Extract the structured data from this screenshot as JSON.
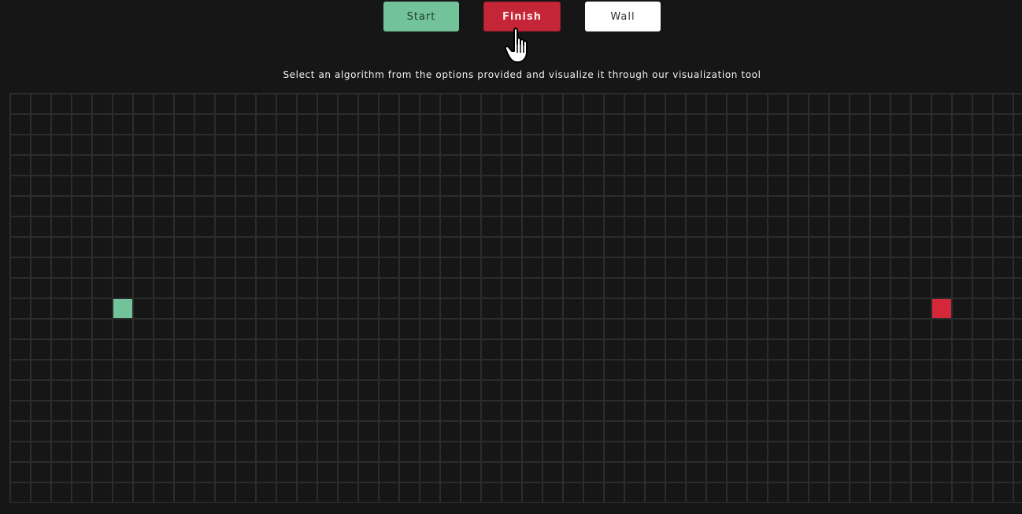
{
  "toolbar": {
    "start_label": "Start",
    "finish_label": "Finish",
    "wall_label": "Wall"
  },
  "subtitle": "Select an algorithm from the options provided and visualize it through our visualization tool",
  "colors": {
    "background": "#161616",
    "grid_line": "#2c2c2c",
    "start": "#72c39a",
    "finish": "#d4283a",
    "wall": "#ffffff"
  },
  "grid": {
    "columns": 50,
    "rows": 20,
    "start_cell": {
      "row": 10,
      "col": 5
    },
    "finish_cell": {
      "row": 10,
      "col": 45
    }
  },
  "cursor": "hand-pointer-icon"
}
